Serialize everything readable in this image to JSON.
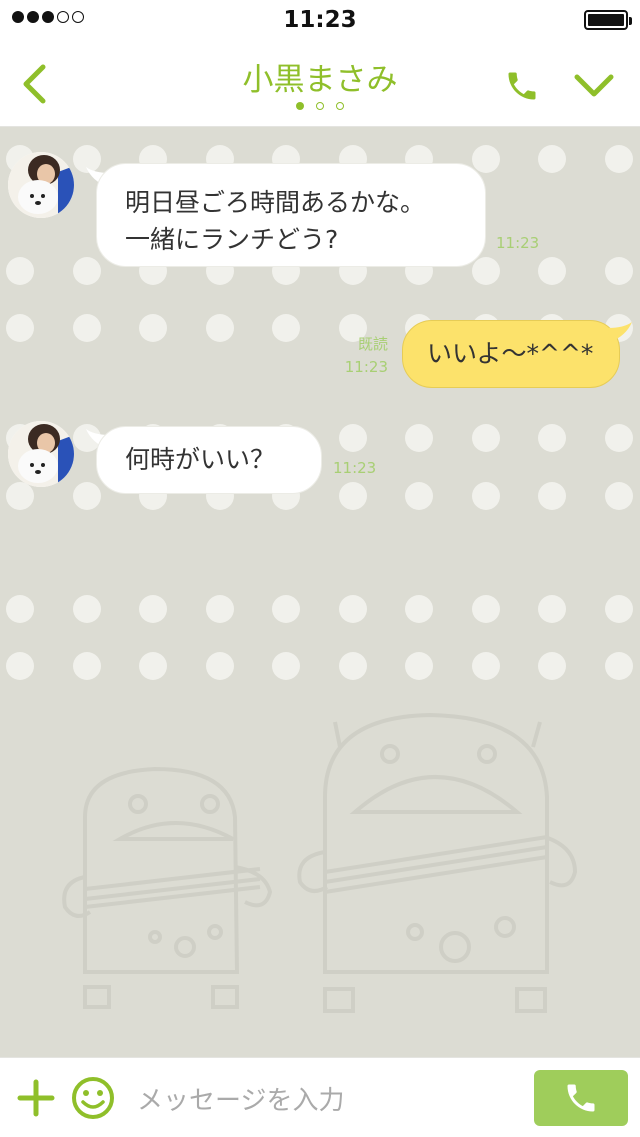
{
  "status": {
    "time": "11:23"
  },
  "header": {
    "title": "小黒まさみ"
  },
  "messages": [
    {
      "side": "left",
      "lines": [
        "明日昼ごろ時間あるかな。",
        "一緒にランチどう?"
      ],
      "time": "11:23"
    },
    {
      "side": "right",
      "text": "いいよ〜*^^*",
      "read": "既読",
      "time": "11:23"
    },
    {
      "side": "left",
      "text": "何時がいい？",
      "time": "11:23"
    }
  ],
  "input": {
    "placeholder": "メッセージを入力"
  },
  "colors": {
    "accent": "#8fbf2a",
    "own_bubble": "#fce26b",
    "background": "#dcdcd3",
    "call_button": "#9fcd5b"
  },
  "icons": [
    "back-chevron-icon",
    "phone-icon",
    "chevron-down-icon",
    "plus-icon",
    "emoji-icon",
    "phone-icon"
  ]
}
